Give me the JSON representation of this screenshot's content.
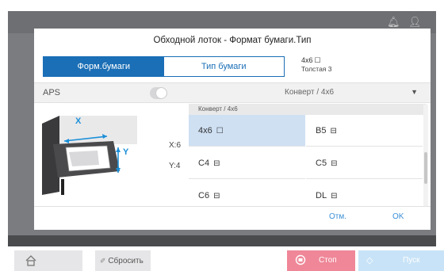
{
  "system_icons": [
    "bell-icon",
    "user-icon"
  ],
  "dialog": {
    "title": "Обходной лоток - Формат бумаги.Тип",
    "tabs": [
      {
        "label": "Форм.бумаги",
        "active": true
      },
      {
        "label": "Тип бумаги",
        "active": false
      }
    ],
    "paper_info": {
      "size": "4x6",
      "size_glyph": "☐",
      "type": "Толстая 3"
    },
    "aps": {
      "label": "APS",
      "enabled": false
    },
    "dropdown": {
      "value": "Конверт  /  4x6",
      "arrow": "▼"
    },
    "illustration": {
      "x_label": "X",
      "y_label": "Y"
    },
    "dimensions": {
      "x": "X:6",
      "y": "Y:4"
    },
    "grid_header": "Конверт  /  4x6",
    "sizes": [
      {
        "label": "4x6",
        "icon": "☐",
        "selected": true
      },
      {
        "label": "B5",
        "icon": "⊟",
        "selected": false
      },
      {
        "label": "C4",
        "icon": "⊟",
        "selected": false
      },
      {
        "label": "C5",
        "icon": "⊟",
        "selected": false
      },
      {
        "label": "C6",
        "icon": "⊟",
        "selected": false
      },
      {
        "label": "DL",
        "icon": "⊟",
        "selected": false
      }
    ],
    "buttons": {
      "cancel": "Отм.",
      "ok": "OK"
    }
  },
  "bottom_bar": {
    "home_icon": "home-icon",
    "reset_label": "Сбросить",
    "stop_label": "Стоп",
    "start_label": "Пуск"
  },
  "colors": {
    "accent": "#1b6fb6",
    "selected": "#cfe0f3",
    "stop": "#ef8798"
  }
}
